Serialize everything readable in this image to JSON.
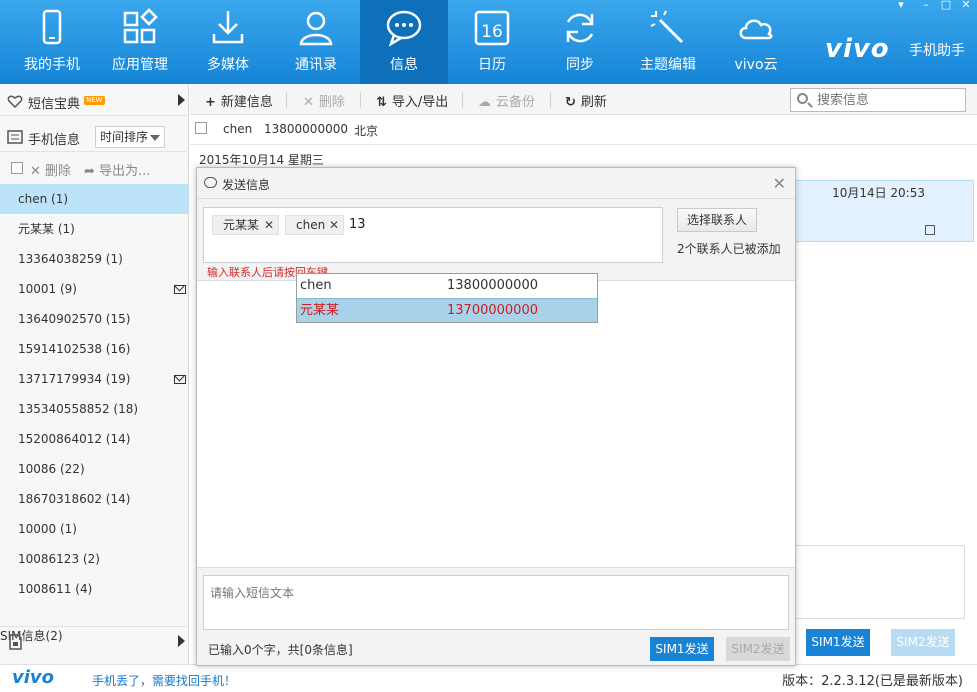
{
  "nav": {
    "items": [
      {
        "label": "我的手机",
        "icon": "phone-icon"
      },
      {
        "label": "应用管理",
        "icon": "apps-icon"
      },
      {
        "label": "多媒体",
        "icon": "download-icon"
      },
      {
        "label": "通讯录",
        "icon": "contacts-icon"
      },
      {
        "label": "信息",
        "icon": "message-icon",
        "active": true
      },
      {
        "label": "日历",
        "icon": "calendar-icon",
        "day": "16"
      },
      {
        "label": "同步",
        "icon": "sync-icon"
      },
      {
        "label": "主题编辑",
        "icon": "theme-wand-icon"
      },
      {
        "label": "vivo云",
        "icon": "cloud-icon"
      }
    ],
    "brand": "vivo",
    "brand_sub": "手机助手",
    "window_buttons": [
      "▾",
      "–",
      "□",
      "✕"
    ]
  },
  "sidebar": {
    "sms_box": {
      "label": "短信宝典",
      "badge": "NEW"
    },
    "phone_msgs": {
      "label": "手机信息",
      "sort": "时间排序"
    },
    "actions": {
      "delete": "删除",
      "export": "导出为..."
    },
    "contacts": [
      {
        "label": "chen (1)",
        "active": true
      },
      {
        "label": "元某某 (1)"
      },
      {
        "label": "13364038259 (1)"
      },
      {
        "label": "10001 (9)",
        "unread": true
      },
      {
        "label": "13640902570 (15)"
      },
      {
        "label": "15914102538 (16)"
      },
      {
        "label": "13717179934 (19)",
        "unread": true
      },
      {
        "label": "135340558852 (18)"
      },
      {
        "label": "15200864012 (14)"
      },
      {
        "label": "10086 (22)"
      },
      {
        "label": "18670318602 (14)"
      },
      {
        "label": "10000 (1)"
      },
      {
        "label": "10086123 (2)"
      },
      {
        "label": "1008611 (4)"
      }
    ],
    "sim_info": "SIM信息(2)"
  },
  "toolbar": {
    "new_msg": "新建信息",
    "delete": "删除",
    "import_export": "导入/导出",
    "cloud_backup": "云备份",
    "refresh": "刷新",
    "search_placeholder": "搜索信息"
  },
  "conversation": {
    "name": "chen",
    "phone": "13800000000",
    "city": "北京",
    "date": "2015年10月14 星期三",
    "bubble_time": "10月14日 20:53",
    "sim1": "SIM1发送",
    "sim2": "SIM2发送"
  },
  "dialog": {
    "title": "发送信息",
    "recipients": [
      "元某某",
      "chen"
    ],
    "typed": "13",
    "select_contact": "选择联系人",
    "added_count": "2个联系人已被添加",
    "hint": "输入联系人后请按回车键",
    "suggestions": [
      {
        "name": "chen",
        "phone": "13800000000"
      },
      {
        "name": "元某某",
        "phone": "13700000000",
        "selected": true
      }
    ],
    "compose_placeholder": "请输入短信文本",
    "char_count": "已输入0个字，共[0条信息]",
    "sim1": "SIM1发送",
    "sim2": "SIM2发送"
  },
  "status": {
    "logo": "vivo",
    "link": "手机丢了，需要找回手机！",
    "version": "版本：2.2.3.12(已是最新版本)"
  }
}
